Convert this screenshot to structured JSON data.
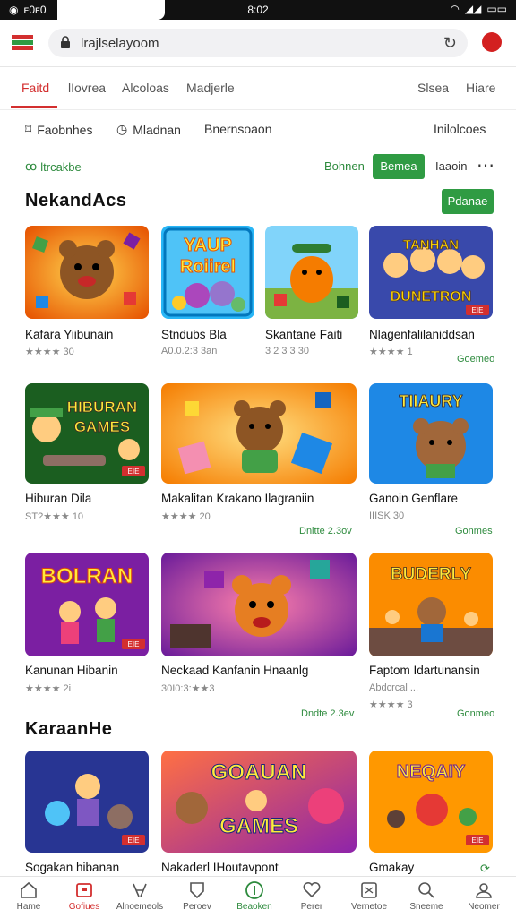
{
  "statusbar": {
    "left": "ᴇ0ᴇ0",
    "time": "8:02"
  },
  "browser": {
    "url": "lrajlselayoom"
  },
  "tabs": [
    {
      "label": "Faitd"
    },
    {
      "label": "lIovrea"
    },
    {
      "label": "Alcoloas"
    },
    {
      "label": "Madjerle"
    },
    {
      "label": "Slsea"
    },
    {
      "label": "Hiare"
    }
  ],
  "filters": [
    {
      "label": "Faobnhes"
    },
    {
      "label": "Mladnan"
    },
    {
      "label": "Bnernsoaon"
    },
    {
      "label": "Inilolcoes"
    }
  ],
  "controls": {
    "label": "ltrcakbe",
    "btn1": "Bohnen",
    "btn2": "Bemea",
    "btn3": "Iaaoin"
  },
  "section1": {
    "title": "NekandAcs",
    "button": "Pdanae"
  },
  "section2": {
    "title": "KaraanHe"
  },
  "games": [
    {
      "name": "Kafara Yiibunain",
      "meta": "★★★★ 30",
      "link": "",
      "badge": "",
      "art": "YAUP"
    },
    {
      "name": "Stndubs Bla",
      "meta": "A0.0.2:3 3an",
      "link": "",
      "badge": "",
      "art": "Yaup Roiirel"
    },
    {
      "name": "Skantane Faiti",
      "meta": "3 2 3 3 30",
      "link": "",
      "badge": "",
      "art": ""
    },
    {
      "name": "Nlagenfalilaniddsan",
      "meta": "★★★★ 1",
      "link": "Goemeo",
      "badge": "EIE",
      "art": "TANHAN DUNETRON"
    },
    {
      "name": "Hiburan Dila",
      "meta": "ST?★★★ 10",
      "link": "",
      "badge": "EIE",
      "art": "HIBURAN GAMES"
    },
    {
      "name": "Makalitan Krakano Ilagraniin",
      "meta": "★★★★ 20",
      "link": "Dnitte 2.3ov",
      "badge": "",
      "art": ""
    },
    {
      "name": "Ganoin Genflare",
      "meta": "IIISK 30",
      "link": "Gonmes",
      "badge": "",
      "art": "TIIAURY"
    },
    {
      "name": "Kanunan Hibanin",
      "meta": "★★★★ 2i",
      "link": "",
      "badge": "EIE",
      "art": "BOLRAN"
    },
    {
      "name": "Neckaad Kanfanin Hnaanlg",
      "meta": "30I0:3:★★3",
      "link": "Dndte 2.3ev",
      "badge": "",
      "art": ""
    },
    {
      "name": "Faptom Idartunansin",
      "meta": "Abdcrcal ...",
      "link": "Gonmeo",
      "badge": "",
      "art": "BUDERLY"
    },
    {
      "name": "Sogakan hibanan",
      "meta": "",
      "link": "",
      "badge": "EIE",
      "art": ""
    },
    {
      "name": "Nakaderl IHoutavpont",
      "meta": "",
      "link": "",
      "badge": "",
      "art": "GOAUAN GAMES"
    },
    {
      "name": "Gmakay",
      "meta": "",
      "link": "",
      "badge": "EIE",
      "art": "NEQAIY"
    }
  ],
  "extra_meta": "★★★★ 3",
  "nav": [
    {
      "label": "Hame"
    },
    {
      "label": "Gofiues"
    },
    {
      "label": "Alnoemeols"
    },
    {
      "label": "Peroev"
    },
    {
      "label": "Beaoken"
    },
    {
      "label": "Perer"
    },
    {
      "label": "Vernetoe"
    },
    {
      "label": "Sneeme"
    },
    {
      "label": "Neomer"
    }
  ],
  "colors": {
    "accent": "#d32f2f",
    "green": "#2f9b43"
  }
}
